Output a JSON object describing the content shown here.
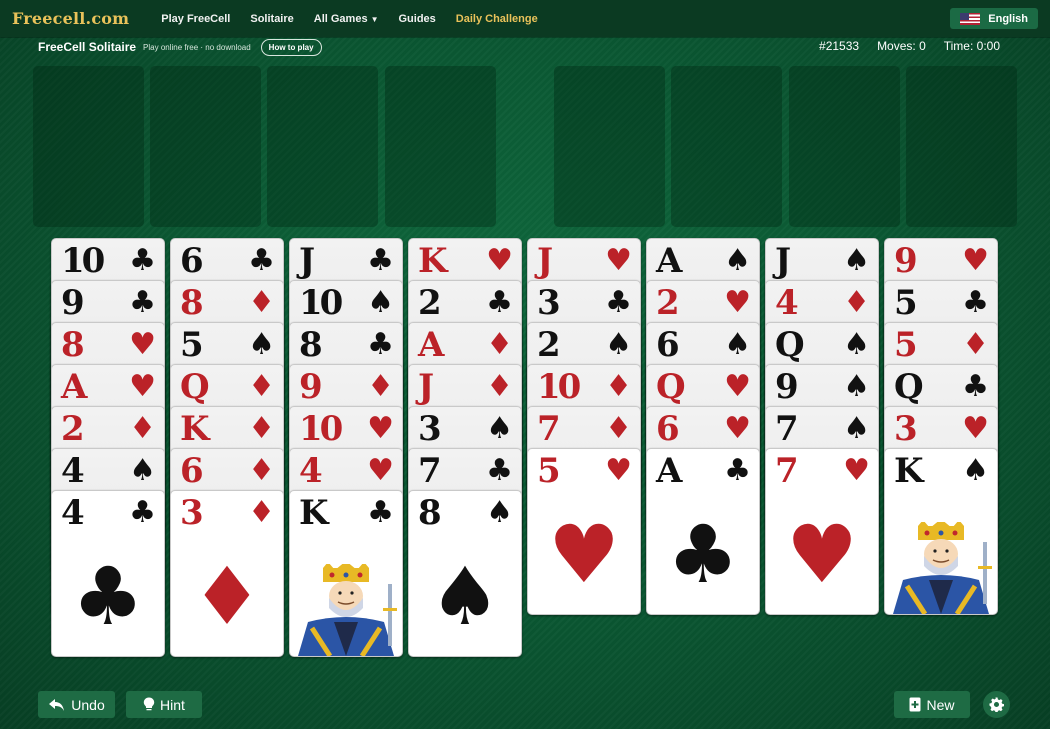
{
  "nav": {
    "logo": "Freecell.com",
    "links": [
      "Play FreeCell",
      "Solitaire",
      "All Games",
      "Guides",
      "Daily Challenge"
    ],
    "language": "English"
  },
  "header": {
    "title": "FreeCell Solitaire",
    "tagline": "Play online free · no download",
    "how_to_play": "How to play",
    "game_number": "#21533",
    "moves": "Moves: 0",
    "time": "Time: 0:00"
  },
  "tableau": [
    [
      {
        "rank": "10",
        "suit": "clubs"
      },
      {
        "rank": "9",
        "suit": "clubs"
      },
      {
        "rank": "8",
        "suit": "hearts"
      },
      {
        "rank": "A",
        "suit": "hearts"
      },
      {
        "rank": "2",
        "suit": "diamonds"
      },
      {
        "rank": "4",
        "suit": "spades"
      },
      {
        "rank": "4",
        "suit": "clubs"
      }
    ],
    [
      {
        "rank": "6",
        "suit": "clubs"
      },
      {
        "rank": "8",
        "suit": "diamonds"
      },
      {
        "rank": "5",
        "suit": "spades"
      },
      {
        "rank": "Q",
        "suit": "diamonds"
      },
      {
        "rank": "K",
        "suit": "diamonds"
      },
      {
        "rank": "6",
        "suit": "diamonds"
      },
      {
        "rank": "3",
        "suit": "diamonds"
      }
    ],
    [
      {
        "rank": "J",
        "suit": "clubs"
      },
      {
        "rank": "10",
        "suit": "spades"
      },
      {
        "rank": "8",
        "suit": "clubs"
      },
      {
        "rank": "9",
        "suit": "diamonds"
      },
      {
        "rank": "10",
        "suit": "hearts"
      },
      {
        "rank": "4",
        "suit": "hearts"
      },
      {
        "rank": "K",
        "suit": "clubs"
      }
    ],
    [
      {
        "rank": "K",
        "suit": "hearts"
      },
      {
        "rank": "2",
        "suit": "clubs"
      },
      {
        "rank": "A",
        "suit": "diamonds"
      },
      {
        "rank": "J",
        "suit": "diamonds"
      },
      {
        "rank": "3",
        "suit": "spades"
      },
      {
        "rank": "7",
        "suit": "clubs"
      },
      {
        "rank": "8",
        "suit": "spades"
      }
    ],
    [
      {
        "rank": "J",
        "suit": "hearts"
      },
      {
        "rank": "3",
        "suit": "clubs"
      },
      {
        "rank": "2",
        "suit": "spades"
      },
      {
        "rank": "10",
        "suit": "diamonds"
      },
      {
        "rank": "7",
        "suit": "diamonds"
      },
      {
        "rank": "5",
        "suit": "hearts"
      }
    ],
    [
      {
        "rank": "A",
        "suit": "spades"
      },
      {
        "rank": "2",
        "suit": "hearts"
      },
      {
        "rank": "6",
        "suit": "spades"
      },
      {
        "rank": "Q",
        "suit": "hearts"
      },
      {
        "rank": "6",
        "suit": "hearts"
      },
      {
        "rank": "A",
        "suit": "clubs"
      }
    ],
    [
      {
        "rank": "J",
        "suit": "spades"
      },
      {
        "rank": "4",
        "suit": "diamonds"
      },
      {
        "rank": "Q",
        "suit": "spades"
      },
      {
        "rank": "9",
        "suit": "spades"
      },
      {
        "rank": "7",
        "suit": "spades"
      },
      {
        "rank": "7",
        "suit": "hearts"
      }
    ],
    [
      {
        "rank": "9",
        "suit": "hearts"
      },
      {
        "rank": "5",
        "suit": "clubs"
      },
      {
        "rank": "5",
        "suit": "diamonds"
      },
      {
        "rank": "Q",
        "suit": "clubs"
      },
      {
        "rank": "3",
        "suit": "hearts"
      },
      {
        "rank": "K",
        "suit": "spades"
      }
    ]
  ],
  "suit_symbols": {
    "clubs": "♣",
    "spades": "♠",
    "hearts": "♥",
    "diamonds": "♦"
  },
  "colors": {
    "red_suit": "#bb2228",
    "black_suit": "#111111",
    "felt": "#0b5a34",
    "button": "#1e6b44",
    "accent": "#e9c25a"
  },
  "footer": {
    "undo": "Undo",
    "hint": "Hint",
    "new": "New"
  }
}
